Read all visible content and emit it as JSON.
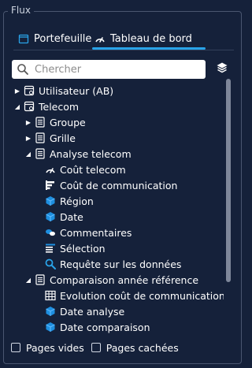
{
  "panel": {
    "title": "Flux"
  },
  "tabs": [
    {
      "label": "Portefeuille",
      "icon": "folder-icon"
    },
    {
      "label": "Tableau de bord",
      "icon": "gauge-icon",
      "active": true
    }
  ],
  "search": {
    "placeholder": "Chercher",
    "value": ""
  },
  "tree": {
    "items": [
      {
        "label": "Utilisateur (AB)",
        "icon": "dataset-icon",
        "expanded": false,
        "has_children": true
      },
      {
        "label": "Telecom",
        "icon": "dataset-icon",
        "expanded": true,
        "has_children": true
      },
      {
        "label": "Groupe",
        "icon": "document-icon",
        "expanded": false,
        "has_children": true
      },
      {
        "label": "Grille",
        "icon": "document-icon",
        "expanded": false,
        "has_children": true
      },
      {
        "label": "Analyse telecom",
        "icon": "document-icon",
        "expanded": true,
        "has_children": true
      },
      {
        "label": "Coût telecom",
        "icon": "gauge-icon",
        "has_children": false
      },
      {
        "label": "Coût de communication",
        "icon": "bar-chart-icon",
        "has_children": false
      },
      {
        "label": "Région",
        "icon": "cube-icon",
        "has_children": false
      },
      {
        "label": "Date",
        "icon": "cube-icon",
        "has_children": false
      },
      {
        "label": "Commentaires",
        "icon": "comment-icon",
        "has_children": false
      },
      {
        "label": "Sélection",
        "icon": "list-icon",
        "has_children": false
      },
      {
        "label": "Requête sur les données",
        "icon": "search-icon",
        "has_children": false
      },
      {
        "label": "Comparaison année référence",
        "icon": "document-icon",
        "expanded": true,
        "has_children": true
      },
      {
        "label": "Evolution coût de communication",
        "icon": "table-icon",
        "has_children": false
      },
      {
        "label": "Date analyse",
        "icon": "cube-icon",
        "has_children": false
      },
      {
        "label": "Date comparaison",
        "icon": "cube-icon",
        "has_children": false
      }
    ]
  },
  "footer": {
    "empty_pages_label": "Pages vides",
    "empty_pages_checked": false,
    "hidden_pages_label": "Pages cachées",
    "hidden_pages_checked": false
  },
  "colors": {
    "background": "#15213a",
    "accent": "#29a3e8",
    "text": "#ffffff"
  }
}
